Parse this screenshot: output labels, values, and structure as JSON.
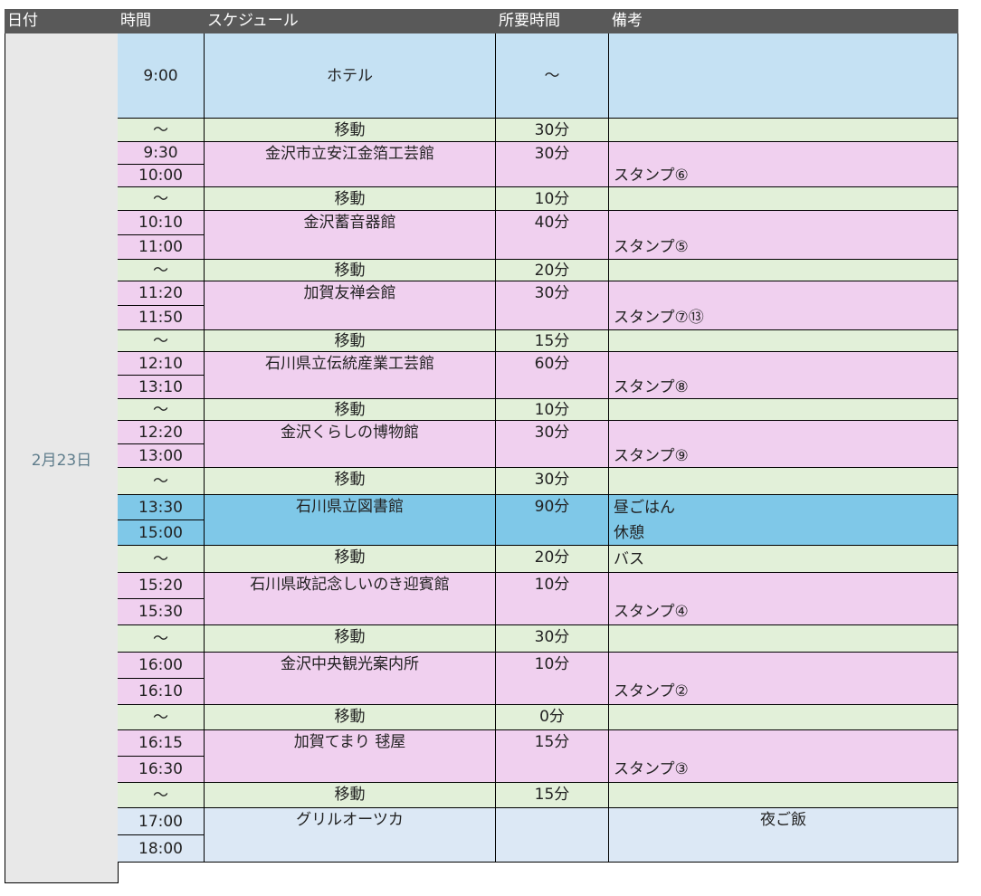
{
  "header": {
    "date": "日付",
    "time": "時間",
    "schedule": "スケジュール",
    "duration": "所要時間",
    "notes": "備考"
  },
  "date_value": "2月23日",
  "colors": {
    "hotel": "#c5e1f3",
    "move": "#e2f0d9",
    "visit": "#f0d0ef",
    "library": "#7fc8e8",
    "dinner": "#dce8f5",
    "header": "#595959"
  },
  "rows": [
    {
      "kind": "hotel",
      "times": [
        "9:00"
      ],
      "name": "ホテル",
      "duration": "～",
      "notes": []
    },
    {
      "kind": "move",
      "times": [
        "～"
      ],
      "name": "移動",
      "duration": "30分",
      "notes": []
    },
    {
      "kind": "visit",
      "times": [
        "9:30",
        "10:00"
      ],
      "name": "金沢市立安江金箔工芸館",
      "duration": "30分",
      "notes": [
        "",
        "スタンプ⑥"
      ]
    },
    {
      "kind": "move",
      "times": [
        "～"
      ],
      "name": "移動",
      "duration": "10分",
      "notes": []
    },
    {
      "kind": "visit",
      "times": [
        "10:10",
        "11:00"
      ],
      "name": "金沢蓄音器館",
      "duration": "40分",
      "notes": [
        "",
        "スタンプ⑤"
      ]
    },
    {
      "kind": "move",
      "times": [
        "～"
      ],
      "name": "移動",
      "duration": "20分",
      "notes": []
    },
    {
      "kind": "visit",
      "times": [
        "11:20",
        "11:50"
      ],
      "name": "加賀友禅会館",
      "duration": "30分",
      "notes": [
        "",
        "スタンプ⑦⑬"
      ]
    },
    {
      "kind": "move",
      "times": [
        "～"
      ],
      "name": "移動",
      "duration": "15分",
      "notes": []
    },
    {
      "kind": "visit",
      "times": [
        "12:10",
        "13:10"
      ],
      "name": "石川県立伝統産業工芸館",
      "duration": "60分",
      "notes": [
        "",
        "スタンプ⑧"
      ]
    },
    {
      "kind": "move",
      "times": [
        "～"
      ],
      "name": "移動",
      "duration": "10分",
      "notes": []
    },
    {
      "kind": "visit",
      "times": [
        "12:20",
        "13:00"
      ],
      "name": "金沢くらしの博物館",
      "duration": "30分",
      "notes": [
        "",
        "スタンプ⑨"
      ]
    },
    {
      "kind": "move",
      "times": [
        "～"
      ],
      "name": "移動",
      "duration": "30分",
      "notes": []
    },
    {
      "kind": "library",
      "times": [
        "13:30",
        "15:00"
      ],
      "name": "石川県立図書館",
      "duration": "90分",
      "notes": [
        "昼ごはん",
        "休憩"
      ]
    },
    {
      "kind": "move",
      "times": [
        "～"
      ],
      "name": "移動",
      "duration": "20分",
      "notes": [
        "バス"
      ]
    },
    {
      "kind": "visit",
      "times": [
        "15:20",
        "15:30"
      ],
      "name": "石川県政記念しいのき迎賓館",
      "duration": "10分",
      "notes": [
        "",
        "スタンプ④"
      ]
    },
    {
      "kind": "move",
      "times": [
        "～"
      ],
      "name": "移動",
      "duration": "30分",
      "notes": []
    },
    {
      "kind": "visit",
      "times": [
        "16:00",
        "16:10"
      ],
      "name": "金沢中央観光案内所",
      "duration": "10分",
      "notes": [
        "",
        "スタンプ②"
      ]
    },
    {
      "kind": "move",
      "times": [
        "～"
      ],
      "name": "移動",
      "duration": "0分",
      "notes": []
    },
    {
      "kind": "visit",
      "times": [
        "16:15",
        "16:30"
      ],
      "name": "加賀てまり 毬屋",
      "duration": "15分",
      "notes": [
        "",
        "スタンプ③"
      ]
    },
    {
      "kind": "move",
      "times": [
        "～"
      ],
      "name": "移動",
      "duration": "15分",
      "notes": []
    },
    {
      "kind": "dinner",
      "times": [
        "17:00",
        "18:00"
      ],
      "name": "グリルオーツカ",
      "duration": "",
      "notes": [
        "夜ご飯"
      ]
    }
  ]
}
